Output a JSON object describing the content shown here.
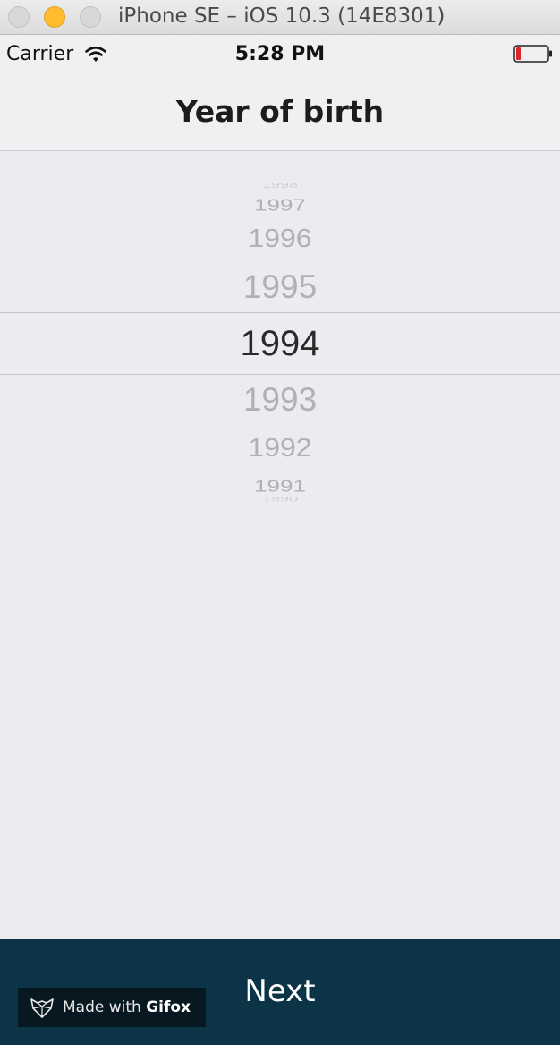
{
  "window": {
    "title": "iPhone SE – iOS 10.3 (14E8301)"
  },
  "status_bar": {
    "carrier": "Carrier",
    "time": "5:28 PM",
    "battery_color": "#e0262b"
  },
  "nav": {
    "title": "Year of birth"
  },
  "picker": {
    "rows": [
      "1998",
      "1997",
      "1996",
      "1995",
      "1994",
      "1993",
      "1992",
      "1991",
      "1990"
    ],
    "selected": "1994"
  },
  "bottom_bar": {
    "background": "#0b3447",
    "next_label": "Next"
  },
  "watermark": {
    "prefix": "Made with ",
    "brand": "Gifox"
  }
}
